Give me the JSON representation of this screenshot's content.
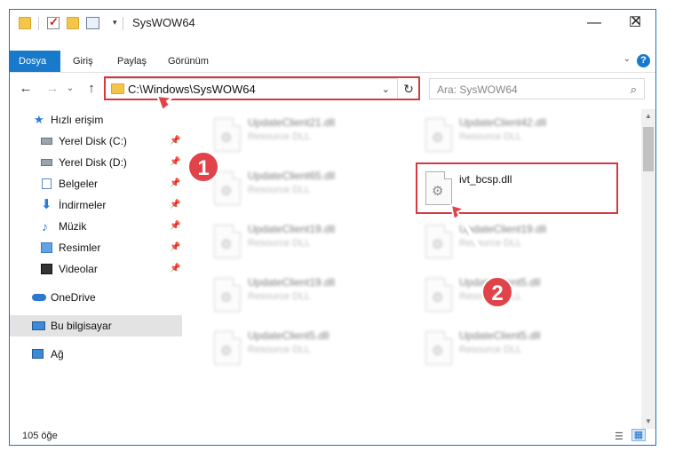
{
  "window": {
    "title": "SysWOW64",
    "minimize": "—",
    "maximize": "☐",
    "close": "✕"
  },
  "ribbon": {
    "tabs": [
      "Dosya",
      "Giriş",
      "Paylaş",
      "Görünüm"
    ],
    "help": "?",
    "collapse": "⌄"
  },
  "nav": {
    "back": "←",
    "forward": "→",
    "recent": "⌄",
    "up": "↑",
    "address": "C:\\Windows\\SysWOW64",
    "address_chevron": "⌄",
    "refresh": "↻",
    "search_placeholder": "Ara: SysWOW64",
    "search_glyph": "⌕"
  },
  "sidebar": {
    "quick_access": "Hızlı erişim",
    "items": [
      {
        "label": "Yerel Disk (C:)",
        "pinned": true,
        "icon": "drive-icon"
      },
      {
        "label": "Yerel Disk (D:)",
        "pinned": true,
        "icon": "drive-icon"
      },
      {
        "label": "Belgeler",
        "pinned": true,
        "icon": "documents-icon"
      },
      {
        "label": "İndirmeler",
        "pinned": true,
        "icon": "downloads-icon"
      },
      {
        "label": "Müzik",
        "pinned": true,
        "icon": "music-icon"
      },
      {
        "label": "Resimler",
        "pinned": true,
        "icon": "pictures-icon"
      },
      {
        "label": "Videolar",
        "pinned": true,
        "icon": "videos-icon"
      }
    ],
    "onedrive": "OneDrive",
    "this_pc": "Bu bilgisayar",
    "network": "Ağ",
    "pin_glyph": "📌"
  },
  "files": [
    {
      "name": "UpdateClient21.dll",
      "type": "Resource DLL"
    },
    {
      "name": "UpdateClient42.dll",
      "type": "Resource DLL"
    },
    {
      "name": "UpdateClient65.dll",
      "type": "Resource DLL"
    },
    {
      "name": "ivt_bcsp.dll",
      "type": ""
    },
    {
      "name": "UpdateClient19.dll",
      "type": "Resource DLL"
    },
    {
      "name": "UpdateClient19.dll",
      "type": "Resource DLL"
    },
    {
      "name": "UpdateClient19.dll",
      "type": "Resource DLL"
    },
    {
      "name": "UpdateClient5.dll",
      "type": "Resource DLL"
    },
    {
      "name": "UpdateClient5.dll",
      "type": "Resource DLL"
    },
    {
      "name": "UpdateClient5.dll",
      "type": "Resource DLL"
    }
  ],
  "status": {
    "count": "105 öğe"
  },
  "annotations": {
    "step1": "1",
    "step2": "2",
    "highlight_color": "#d63a3f"
  },
  "colors": {
    "accent": "#1979ca",
    "annotation": "#e0434a"
  }
}
